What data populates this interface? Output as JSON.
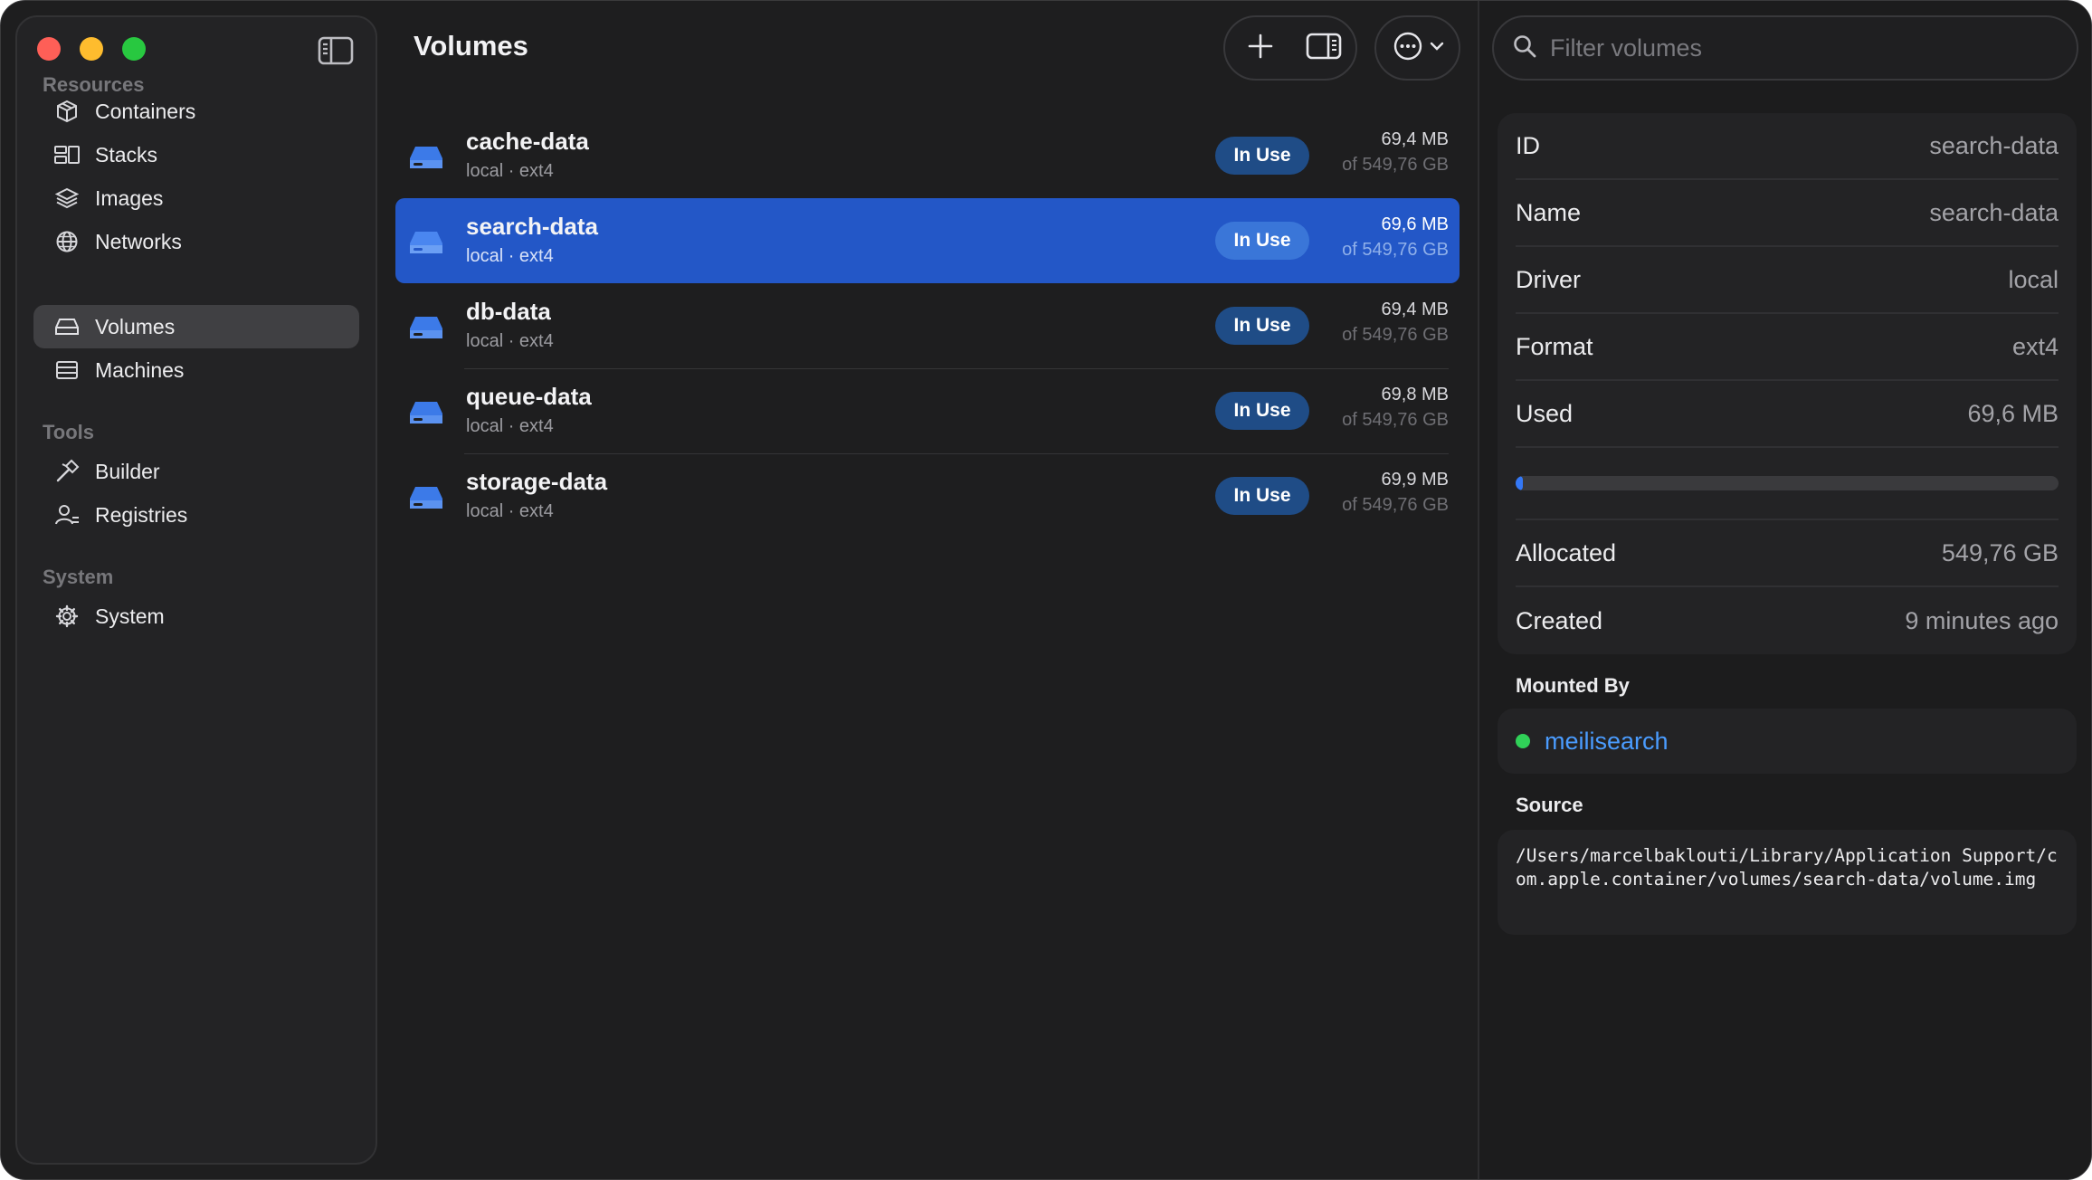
{
  "sidebar": {
    "sections": [
      {
        "label": "Resources"
      },
      {
        "label": "Tools"
      },
      {
        "label": "System"
      }
    ],
    "items": [
      {
        "label": "Containers",
        "icon": "cube-icon"
      },
      {
        "label": "Stacks",
        "icon": "stacks-icon"
      },
      {
        "label": "Images",
        "icon": "layers-icon"
      },
      {
        "label": "Networks",
        "icon": "globe-icon"
      },
      {
        "label": "Volumes",
        "icon": "drive-icon",
        "active": true
      },
      {
        "label": "Machines",
        "icon": "server-icon"
      },
      {
        "label": "Builder",
        "icon": "hammer-icon"
      },
      {
        "label": "Registries",
        "icon": "registry-icon"
      },
      {
        "label": "System",
        "icon": "gear-icon"
      }
    ]
  },
  "header": {
    "title": "Volumes"
  },
  "volumes": [
    {
      "name": "cache-data",
      "meta": "local · ext4",
      "status": "In Use",
      "size": "69,4 MB",
      "total": "of 549,76 GB"
    },
    {
      "name": "search-data",
      "meta": "local · ext4",
      "status": "In Use",
      "size": "69,6 MB",
      "total": "of 549,76 GB",
      "selected": true
    },
    {
      "name": "db-data",
      "meta": "local · ext4",
      "status": "In Use",
      "size": "69,4 MB",
      "total": "of 549,76 GB"
    },
    {
      "name": "queue-data",
      "meta": "local · ext4",
      "status": "In Use",
      "size": "69,8 MB",
      "total": "of 549,76 GB"
    },
    {
      "name": "storage-data",
      "meta": "local · ext4",
      "status": "In Use",
      "size": "69,9 MB",
      "total": "of 549,76 GB"
    }
  ],
  "inspector": {
    "filter_placeholder": "Filter volumes",
    "props": {
      "id": {
        "key": "ID",
        "value": "search-data"
      },
      "name": {
        "key": "Name",
        "value": "search-data"
      },
      "driver": {
        "key": "Driver",
        "value": "local"
      },
      "format": {
        "key": "Format",
        "value": "ext4"
      },
      "used": {
        "key": "Used",
        "value": "69,6 MB"
      },
      "allocated": {
        "key": "Allocated",
        "value": "549,76 GB"
      },
      "created": {
        "key": "Created",
        "value": "9 minutes ago"
      }
    },
    "usage_fraction": 0.0001,
    "mounted_by_title": "Mounted By",
    "mounted_by": "meilisearch",
    "source_title": "Source",
    "source_path": "/Users/marcelbaklouti/Library/Application Support/com.apple.container/volumes/search-data/volume.img"
  },
  "colors": {
    "accent": "#2357c7",
    "badge": "#1f4c86",
    "link": "#4a9cff",
    "status_green": "#30d158"
  }
}
